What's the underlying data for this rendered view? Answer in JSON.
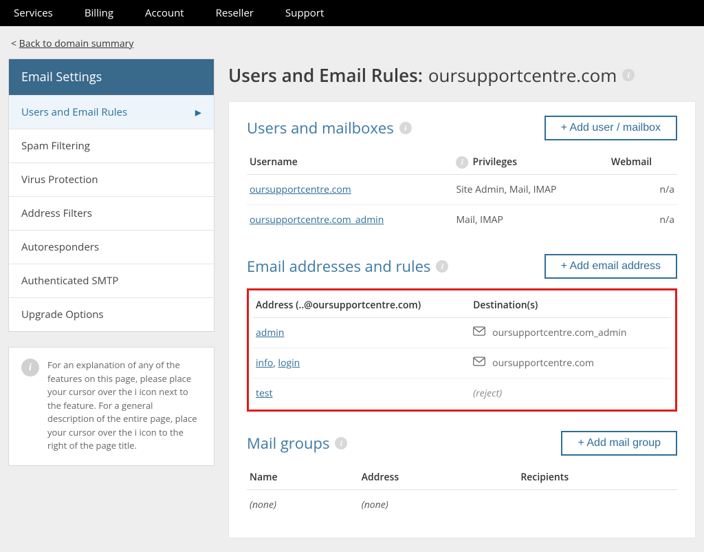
{
  "topnav": [
    "Services",
    "Billing",
    "Account",
    "Reseller",
    "Support"
  ],
  "backlink_prefix": "< ",
  "backlink": "Back to domain summary",
  "sidebar": {
    "header": "Email Settings",
    "items": [
      {
        "label": "Users and Email Rules",
        "active": true
      },
      {
        "label": "Spam Filtering"
      },
      {
        "label": "Virus Protection"
      },
      {
        "label": "Address Filters"
      },
      {
        "label": "Autoresponders"
      },
      {
        "label": "Authenticated SMTP"
      },
      {
        "label": "Upgrade Options"
      }
    ],
    "info": "For an explanation of any of the features on this page, please place your cursor over the i icon next to the feature. For a general description of the entire page, place your cursor over the i icon to the right of the page title."
  },
  "page": {
    "title_prefix": "Users and Email Rules:",
    "domain": "oursupportcentre.com"
  },
  "users": {
    "title": "Users and mailboxes",
    "add_btn": "+ Add user / mailbox",
    "cols": {
      "username": "Username",
      "privileges": "Privileges",
      "webmail": "Webmail"
    },
    "rows": [
      {
        "username": "oursupportcentre.com",
        "privileges": "Site Admin, Mail, IMAP",
        "webmail": "n/a"
      },
      {
        "username": "oursupportcentre.com_admin",
        "privileges": "Mail, IMAP",
        "webmail": "n/a"
      }
    ]
  },
  "addresses": {
    "title": "Email addresses and rules",
    "add_btn": "+ Add email address",
    "cols": {
      "address": "Address (..@oursupportcentre.com)",
      "dest": "Destination(s)"
    },
    "rows": [
      {
        "addresses": [
          "admin"
        ],
        "dest_type": "mailbox",
        "dest": "oursupportcentre.com_admin"
      },
      {
        "addresses": [
          "info",
          "login"
        ],
        "dest_type": "mailbox",
        "dest": "oursupportcentre.com"
      },
      {
        "addresses": [
          "test"
        ],
        "dest_type": "reject",
        "dest": "(reject)"
      }
    ]
  },
  "groups": {
    "title": "Mail groups",
    "add_btn": "+ Add mail group",
    "cols": {
      "name": "Name",
      "address": "Address",
      "recipients": "Recipients"
    },
    "none": "(none)"
  }
}
